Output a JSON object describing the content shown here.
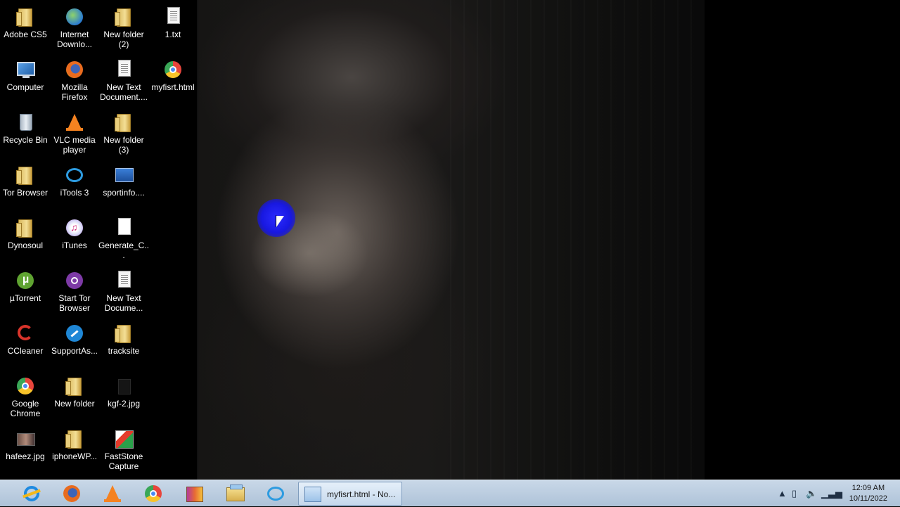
{
  "desktop_icons": [
    {
      "label": "Adobe CS5",
      "icon": "folder-icon"
    },
    {
      "label": "Internet Downlo...",
      "icon": "internet-download-manager-icon"
    },
    {
      "label": "New folder (2)",
      "icon": "folder-icon"
    },
    {
      "label": "1.txt",
      "icon": "text-file-icon"
    },
    {
      "label": "Computer",
      "icon": "computer-icon"
    },
    {
      "label": "Mozilla Firefox",
      "icon": "firefox-icon"
    },
    {
      "label": "New Text Document....",
      "icon": "text-file-icon"
    },
    {
      "label": "myfisrt.html",
      "icon": "chrome-icon"
    },
    {
      "label": "Recycle Bin",
      "icon": "recycle-bin-icon"
    },
    {
      "label": "VLC media player",
      "icon": "vlc-icon"
    },
    {
      "label": "New folder (3)",
      "icon": "folder-icon"
    },
    {
      "label": "Tor Browser",
      "icon": "folder-icon"
    },
    {
      "label": "iTools 3",
      "icon": "itools-icon"
    },
    {
      "label": "sportinfo....",
      "icon": "sportinfo-icon"
    },
    {
      "label": "Dynosoul",
      "icon": "folder-icon"
    },
    {
      "label": "iTunes",
      "icon": "itunes-icon"
    },
    {
      "label": "Generate_C...",
      "icon": "blank-file-icon"
    },
    {
      "label": "µTorrent",
      "icon": "utorrent-icon"
    },
    {
      "label": "Start Tor Browser",
      "icon": "tor-icon"
    },
    {
      "label": "New Text Docume...",
      "icon": "text-file-icon"
    },
    {
      "label": "CCleaner",
      "icon": "ccleaner-icon"
    },
    {
      "label": "SupportAs...",
      "icon": "supportassist-icon"
    },
    {
      "label": "tracksite",
      "icon": "folder-icon"
    },
    {
      "label": "Google Chrome",
      "icon": "chrome-icon"
    },
    {
      "label": "New folder",
      "icon": "folder-icon"
    },
    {
      "label": "kgf-2.jpg",
      "icon": "image-file-icon"
    },
    {
      "label": "hafeez.jpg",
      "icon": "image-thumbnail-icon"
    },
    {
      "label": "iphoneWP...",
      "icon": "folder-icon"
    },
    {
      "label": "FastStone Capture",
      "icon": "faststone-capture-icon"
    }
  ],
  "taskbar": {
    "pinned": [
      "internet-explorer-icon",
      "firefox-icon",
      "vlc-icon",
      "chrome-icon",
      "winrar-icon",
      "file-explorer-icon",
      "itools-icon"
    ],
    "active_window": {
      "title": "myfisrt.html - No...",
      "icon": "notepad-icon"
    },
    "clock": {
      "time": "12:09 AM",
      "date": "10/11/2022"
    }
  }
}
